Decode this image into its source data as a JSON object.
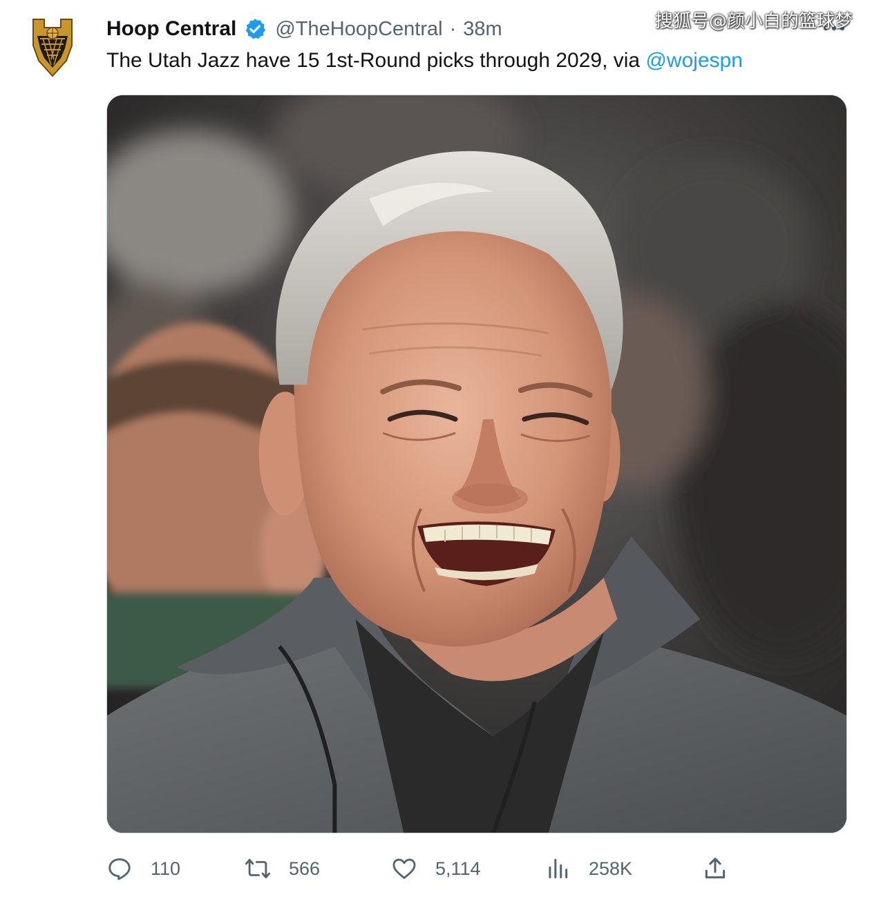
{
  "watermark": "搜狐号@颜小白的篮球梦",
  "author": {
    "display_name": "Hoop Central",
    "handle": "@TheHoopCentral",
    "separator": "·",
    "time": "38m",
    "verified": true,
    "avatar_icon": "hoop-central-logo"
  },
  "tweet": {
    "text": "The Utah Jazz have 15 1st-Round picks through 2029, via ",
    "mention": "@wojespn"
  },
  "media": {
    "icon": "photo-of-smiling-man"
  },
  "actions": {
    "reply": {
      "icon": "reply-icon",
      "count": "110"
    },
    "retweet": {
      "icon": "retweet-icon",
      "count": "566"
    },
    "like": {
      "icon": "heart-icon",
      "count": "5,114"
    },
    "views": {
      "icon": "views-icon",
      "count": "258K"
    },
    "share": {
      "icon": "share-icon"
    }
  },
  "colors": {
    "text": "#0f1419",
    "muted": "#536471",
    "link": "#1d9bf0",
    "verified": "#1d9bf0",
    "logo_gold": "#c9962c"
  }
}
